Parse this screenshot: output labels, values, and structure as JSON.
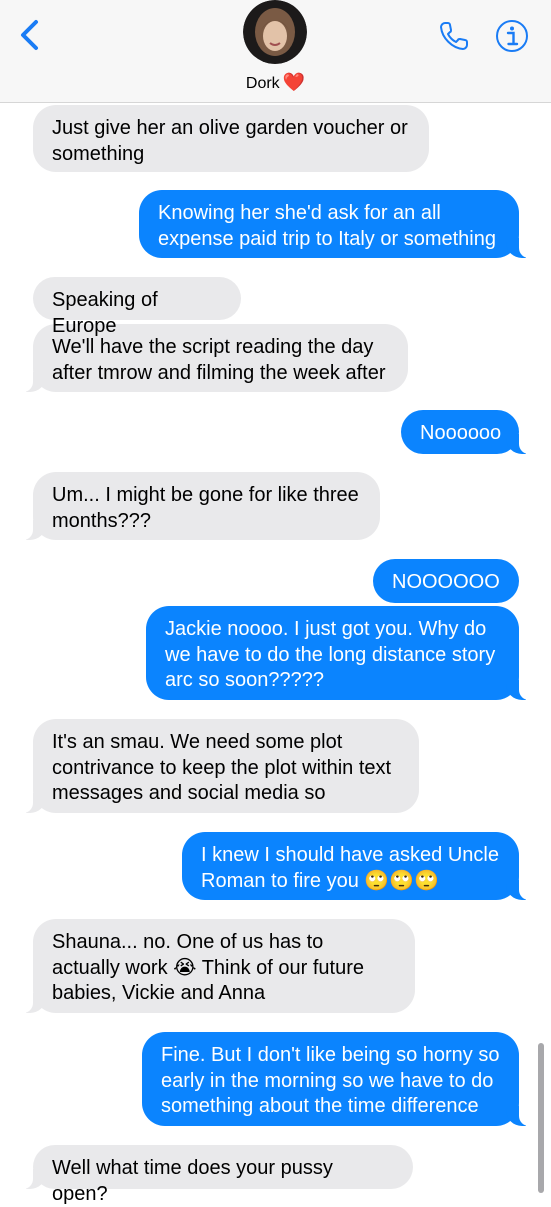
{
  "header": {
    "contact_name": "Dork",
    "contact_emoji": "❤️"
  },
  "messages": [
    {
      "side": "in",
      "text": "Just give her an olive garden voucher or something"
    },
    {
      "side": "out",
      "text": "Knowing her she'd ask for an all expense paid trip to Italy or something"
    },
    {
      "side": "in",
      "text": "Speaking of Europe"
    },
    {
      "side": "in",
      "text": "We'll have the script reading the day after tmrow and filming the week after"
    },
    {
      "side": "out",
      "text": "Noooooo"
    },
    {
      "side": "in",
      "text": "Um... I might be gone for like three months???"
    },
    {
      "side": "out",
      "text": "NOOOOOO"
    },
    {
      "side": "out",
      "text": "Jackie noooo. I just got you. Why do we have to do the long distance story arc so soon?????"
    },
    {
      "side": "in",
      "text": "It's an smau. We need some plot contrivance to keep the plot within text messages and social media so"
    },
    {
      "side": "out",
      "text": "I knew I should have asked Uncle Roman to fire you 🙄🙄🙄"
    },
    {
      "side": "in",
      "text": "Shauna... no. One of us has to actually work 😭 Think of our future babies, Vickie and Anna"
    },
    {
      "side": "out",
      "text": "Fine. But I don't like being so horny so early in the morning so we have to do something about the time difference"
    },
    {
      "side": "in",
      "text": "Well what time does your pussy open?"
    }
  ],
  "colors": {
    "outgoing_bubble": "#0b84fe",
    "incoming_bubble": "#e9e9eb",
    "accent": "#1a7cf5"
  },
  "icons": [
    "back-chevron-icon",
    "phone-icon",
    "info-icon"
  ]
}
